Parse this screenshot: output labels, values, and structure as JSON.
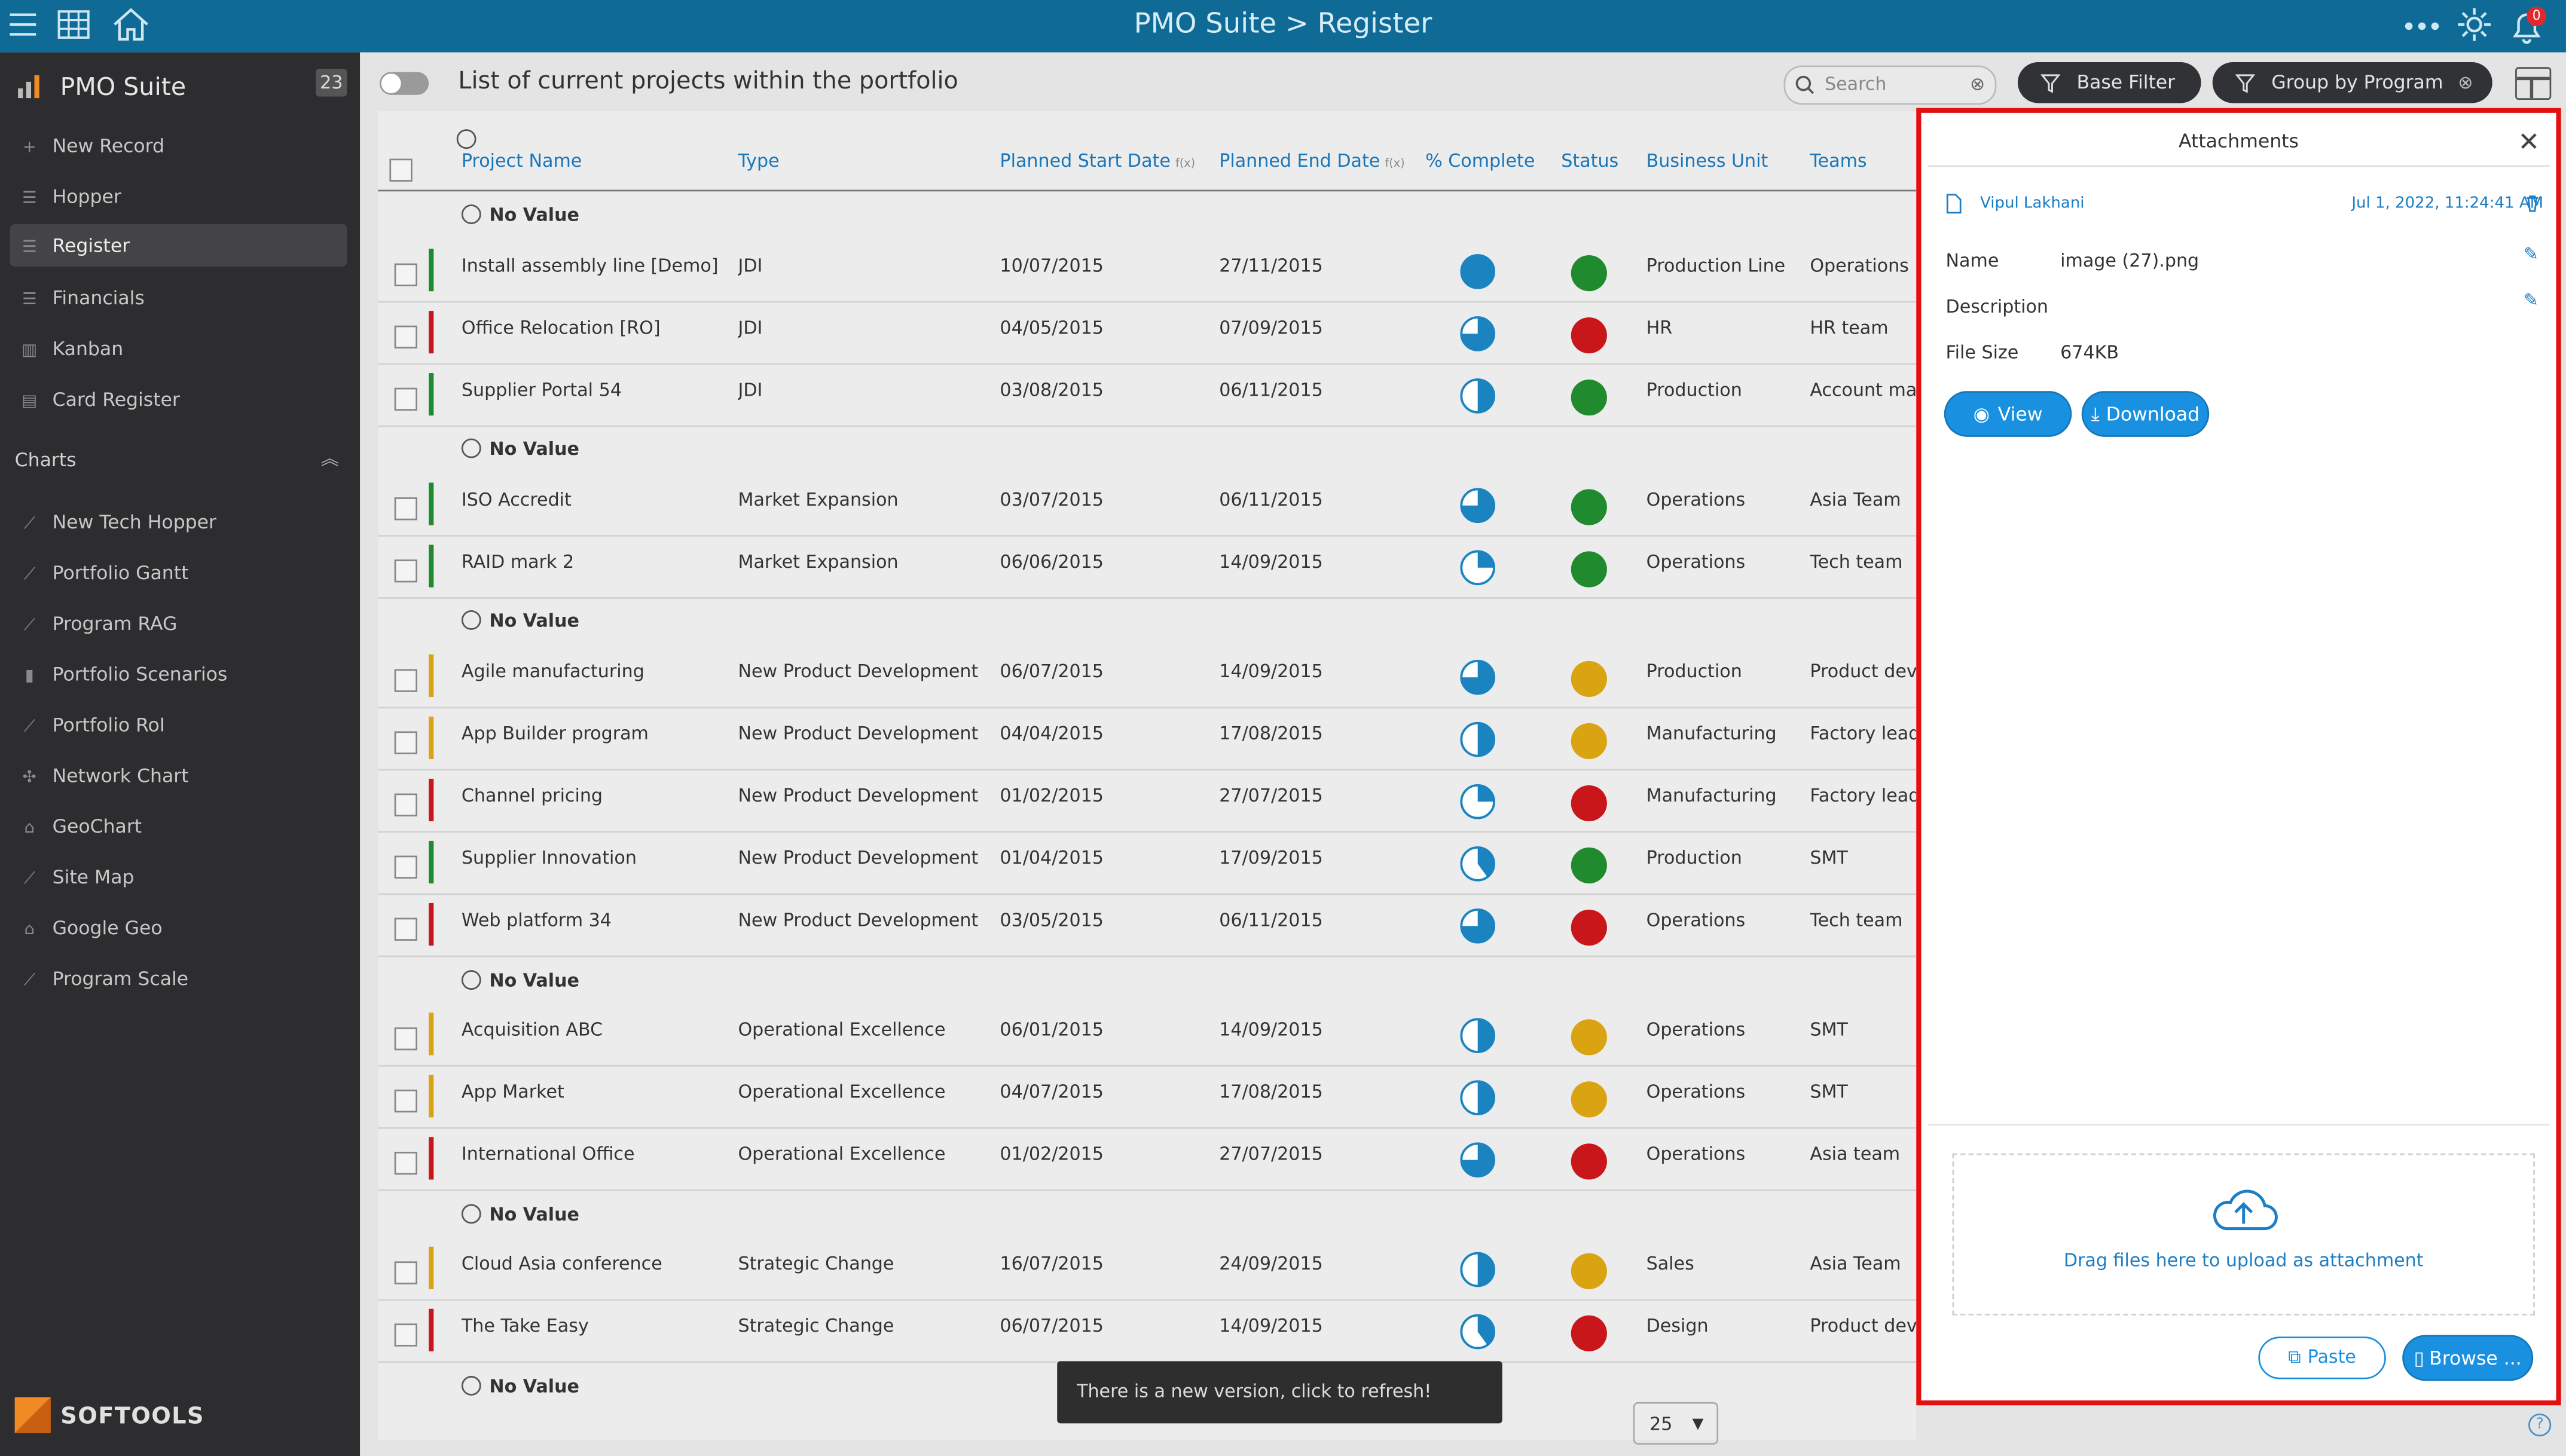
{
  "app": {
    "title": "PMO Suite > Register",
    "notification_count": "0"
  },
  "sidebar": {
    "brand": "PMO Suite",
    "badge": "23",
    "items": [
      {
        "label": "New Record",
        "icon": "plus-icon"
      },
      {
        "label": "Hopper",
        "icon": "list-icon"
      },
      {
        "label": "Register",
        "icon": "list-icon"
      },
      {
        "label": "Financials",
        "icon": "list-icon"
      },
      {
        "label": "Kanban",
        "icon": "kanban-icon"
      },
      {
        "label": "Card Register",
        "icon": "card-icon"
      }
    ],
    "charts_heading": "Charts",
    "charts": [
      {
        "label": "New Tech Hopper"
      },
      {
        "label": "Portfolio Gantt"
      },
      {
        "label": "Program RAG"
      },
      {
        "label": "Portfolio Scenarios"
      },
      {
        "label": "Portfolio RoI"
      },
      {
        "label": "Network Chart"
      },
      {
        "label": "GeoChart"
      },
      {
        "label": "Site Map"
      },
      {
        "label": "Google Geo"
      },
      {
        "label": "Program Scale"
      }
    ],
    "footer_brand": "SOFTOOLS"
  },
  "toolbar": {
    "page_title": "List of current projects within the portfolio",
    "search_placeholder": "Search",
    "base_filter": "Base Filter",
    "group_by": "Group by Program"
  },
  "table": {
    "headers": [
      "Project Name",
      "Type",
      "Planned Start Date",
      "Planned End Date",
      "% Complete",
      "Status",
      "Business Unit",
      "Teams"
    ],
    "fx_badge": "f(x)",
    "group_label": "No Value",
    "rows": [
      {
        "name": "Install assembly line [Demo]",
        "type": "JDI",
        "start": "10/07/2015",
        "end": "27/11/2015",
        "complete": 1.0,
        "status": "green",
        "unit": "Production Line",
        "team": "Operations",
        "flag": "green"
      },
      {
        "name": "Office Relocation [RO]",
        "type": "JDI",
        "start": "04/05/2015",
        "end": "07/09/2015",
        "complete": 0.75,
        "status": "red",
        "unit": "HR",
        "team": "HR team",
        "flag": "red"
      },
      {
        "name": "Supplier Portal 54",
        "type": "JDI",
        "start": "03/08/2015",
        "end": "06/11/2015",
        "complete": 0.5,
        "status": "green",
        "unit": "Production",
        "team": "Account ma",
        "flag": "green"
      },
      {
        "name": "ISO Accredit",
        "type": "Market Expansion",
        "start": "03/07/2015",
        "end": "06/11/2015",
        "complete": 0.75,
        "status": "green",
        "unit": "Operations",
        "team": "Asia Team",
        "flag": "green"
      },
      {
        "name": "RAID mark 2",
        "type": "Market Expansion",
        "start": "06/06/2015",
        "end": "14/09/2015",
        "complete": 0.25,
        "status": "green",
        "unit": "Operations",
        "team": "Tech team",
        "flag": "green"
      },
      {
        "name": "Agile manufacturing",
        "type": "New Product Development",
        "start": "06/07/2015",
        "end": "14/09/2015",
        "complete": 0.75,
        "status": "amber",
        "unit": "Production",
        "team": "Product dev",
        "flag": "amber"
      },
      {
        "name": "App Builder program",
        "type": "New Product Development",
        "start": "04/04/2015",
        "end": "17/08/2015",
        "complete": 0.5,
        "status": "amber",
        "unit": "Manufacturing",
        "team": "Factory lead",
        "flag": "amber"
      },
      {
        "name": "Channel pricing",
        "type": "New Product Development",
        "start": "01/02/2015",
        "end": "27/07/2015",
        "complete": 0.25,
        "status": "red",
        "unit": "Manufacturing",
        "team": "Factory lead",
        "flag": "red"
      },
      {
        "name": "Supplier Innovation",
        "type": "New Product Development",
        "start": "01/04/2015",
        "end": "17/09/2015",
        "complete": 0.4,
        "status": "green",
        "unit": "Production",
        "team": "SMT",
        "flag": "green"
      },
      {
        "name": "Web platform 34",
        "type": "New Product Development",
        "start": "03/05/2015",
        "end": "06/11/2015",
        "complete": 0.75,
        "status": "red",
        "unit": "Operations",
        "team": "Tech team",
        "flag": "red"
      },
      {
        "name": "Acquisition ABC",
        "type": "Operational Excellence",
        "start": "06/01/2015",
        "end": "14/09/2015",
        "complete": 0.5,
        "status": "amber",
        "unit": "Operations",
        "team": "SMT",
        "flag": "amber"
      },
      {
        "name": "App Market",
        "type": "Operational Excellence",
        "start": "04/07/2015",
        "end": "17/08/2015",
        "complete": 0.5,
        "status": "amber",
        "unit": "Operations",
        "team": "SMT",
        "flag": "amber"
      },
      {
        "name": "International Office",
        "type": "Operational Excellence",
        "start": "01/02/2015",
        "end": "27/07/2015",
        "complete": 0.75,
        "status": "red",
        "unit": "Operations",
        "team": "Asia team",
        "flag": "red"
      },
      {
        "name": "Cloud Asia conference",
        "type": "Strategic Change",
        "start": "16/07/2015",
        "end": "24/09/2015",
        "complete": 0.5,
        "status": "amber",
        "unit": "Sales",
        "team": "Asia Team",
        "flag": "amber"
      },
      {
        "name": "The Take Easy",
        "type": "Strategic Change",
        "start": "06/07/2015",
        "end": "14/09/2015",
        "complete": 0.4,
        "status": "red",
        "unit": "Design",
        "team": "Product dev",
        "flag": "red"
      }
    ]
  },
  "toast": "There is a new version, click to refresh!",
  "pager": {
    "page_size": "25"
  },
  "attachments": {
    "title": "Attachments",
    "user": "Vipul Lakhani",
    "date": "Jul 1, 2022, 11:24:41 AM",
    "name_label": "Name",
    "name_value": "image (27).png",
    "description_label": "Description",
    "size_label": "File Size",
    "size_value": "674KB",
    "view": "View",
    "download": "Download",
    "drop_text": "Drag files here to upload as attachment",
    "paste": "Paste",
    "browse": "Browse ..."
  },
  "colors": {
    "green": "#1f8a2e",
    "red": "#c8161b",
    "amber": "#d9a312",
    "pie_blue": "#1a83c0",
    "accent": "#1a90e0"
  }
}
